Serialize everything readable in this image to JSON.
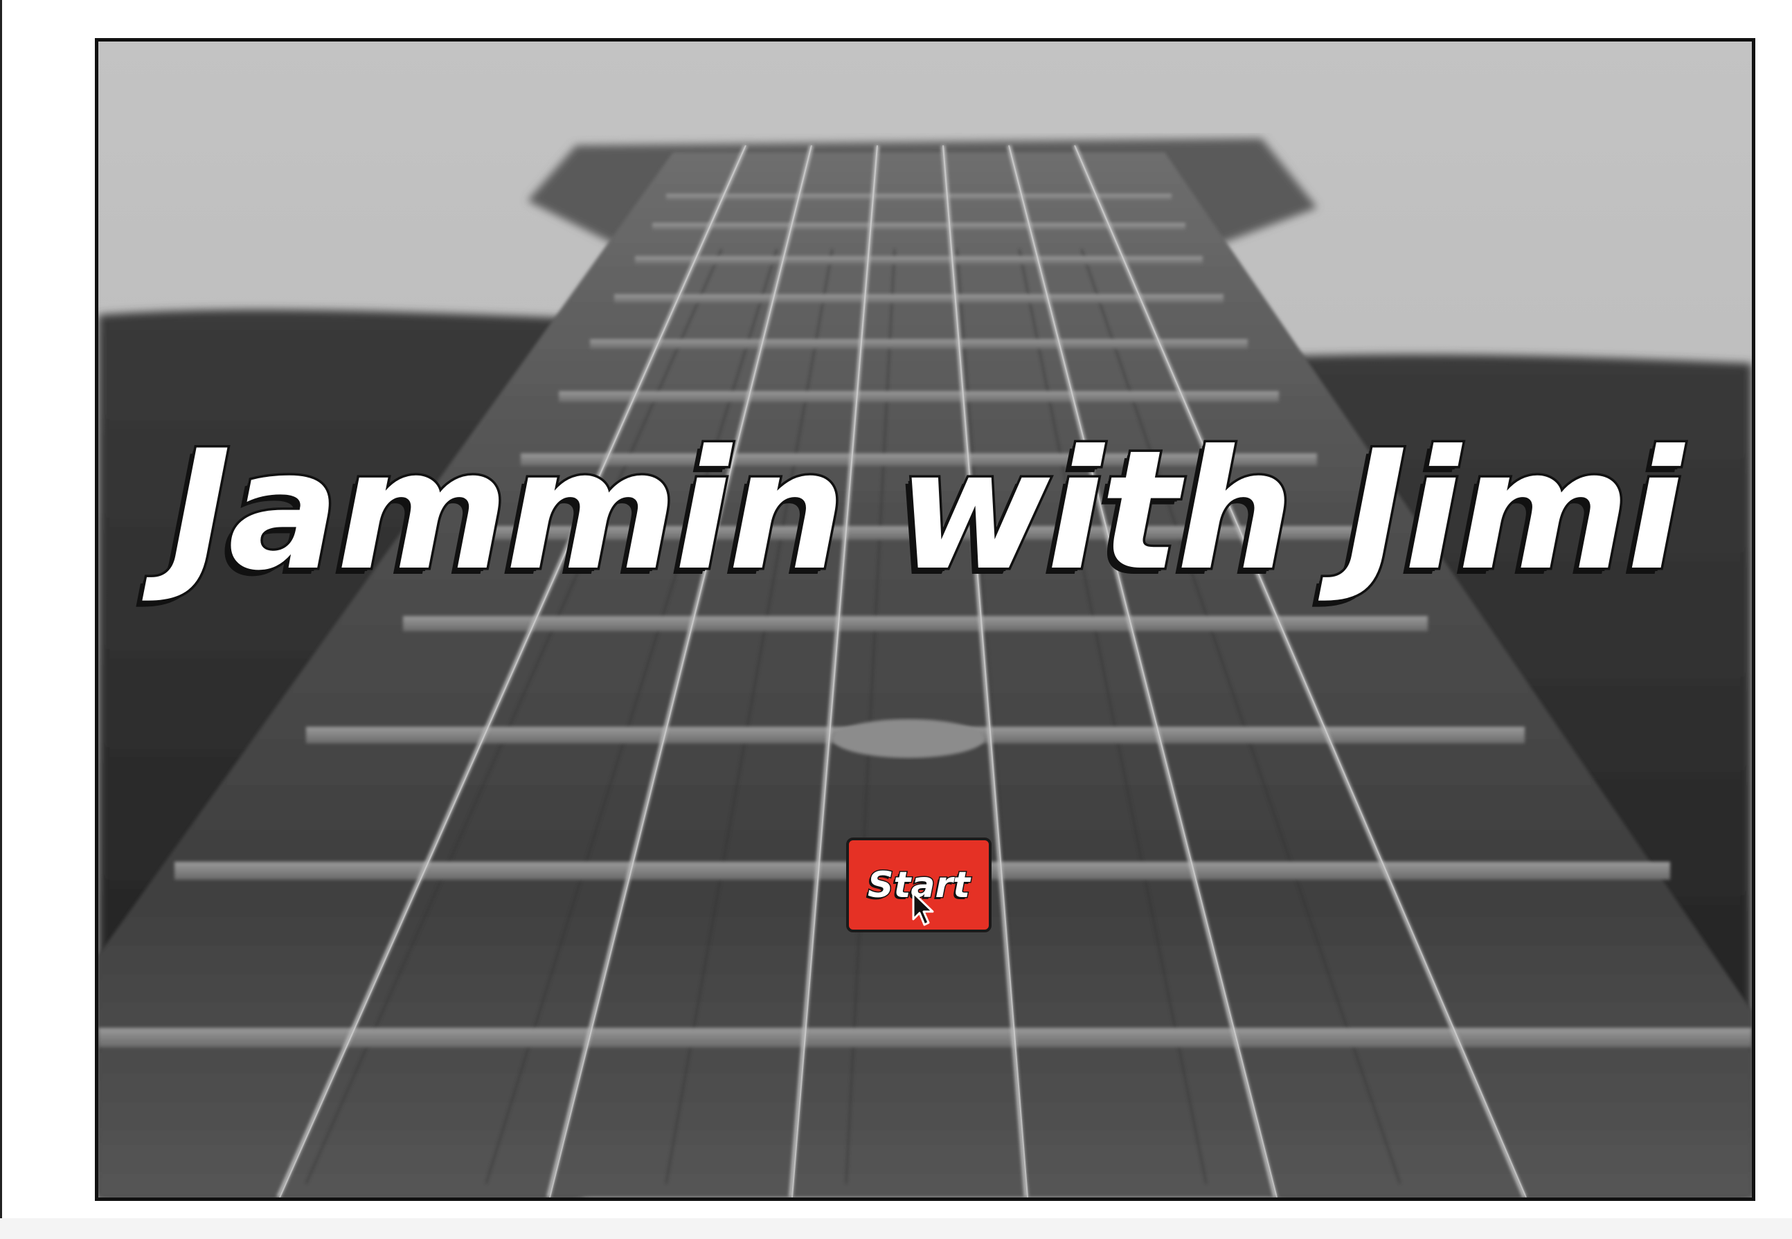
{
  "game": {
    "title": "Jammin with Jimi",
    "start_label": "Start",
    "background": "guitar-fretboard-photo",
    "colors": {
      "start_button": "#e53125",
      "title_fill": "#ffffff",
      "outline": "#111111"
    }
  },
  "icons": {
    "cursor": "mouse-pointer-icon"
  }
}
